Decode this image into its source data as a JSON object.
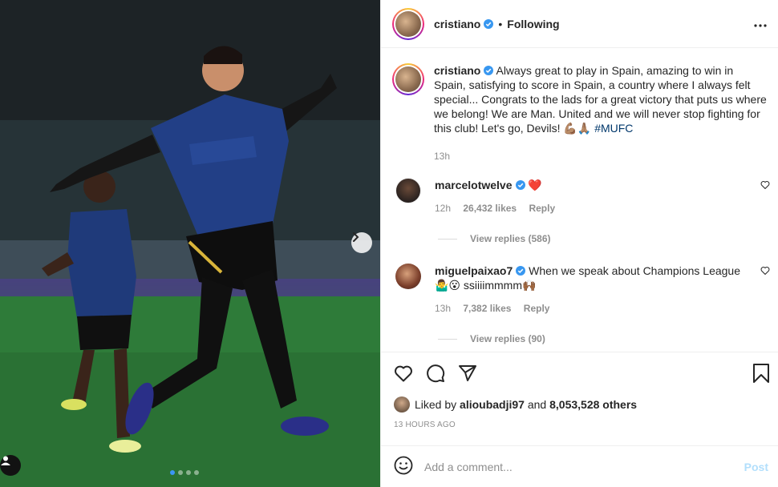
{
  "post": {
    "username": "cristiano",
    "separator": "•",
    "follow_status": "Following",
    "more_icon": "more-horizontal-icon",
    "caption": "Always great to play in Spain, amazing to win in Spain, satisfying to score in Spain, a country where I always felt special... Congrats to the lads for a great victory that puts us where we belong! We are Man. United and we will never stop fighting for this club! Let's go, Devils!",
    "caption_emoji": "💪🏽🙏🏽",
    "hashtag": "#MUFC",
    "caption_time": "13h",
    "carousel": {
      "slide_count": 4,
      "active_index": 0
    }
  },
  "comments": [
    {
      "username": "marcelotwelve",
      "text": "❤️",
      "time": "12h",
      "likes": "26,432 likes",
      "reply_label": "Reply",
      "view_replies": "View replies (586)"
    },
    {
      "username": "miguelpaixao7",
      "text": "When we speak about Champions League",
      "text2_emoji": "🤷‍♂️😮",
      "text2": " ssiiiimmmm🙌🏾",
      "time": "13h",
      "likes": "7,382 likes",
      "reply_label": "Reply",
      "view_replies": "View replies (90)"
    }
  ],
  "actions": {
    "liked_by_prefix": "Liked by",
    "liked_by_user": "alioubadji97",
    "liked_by_and": "and",
    "liked_by_others": "8,053,528 others",
    "timestamp": "13 HOURS AGO"
  },
  "composer": {
    "placeholder": "Add a comment...",
    "post_label": "Post"
  },
  "colors": {
    "verified": "#3897f0",
    "link": "#00376b",
    "muted": "#8e8e8e",
    "post_disabled": "#b2dffc"
  }
}
